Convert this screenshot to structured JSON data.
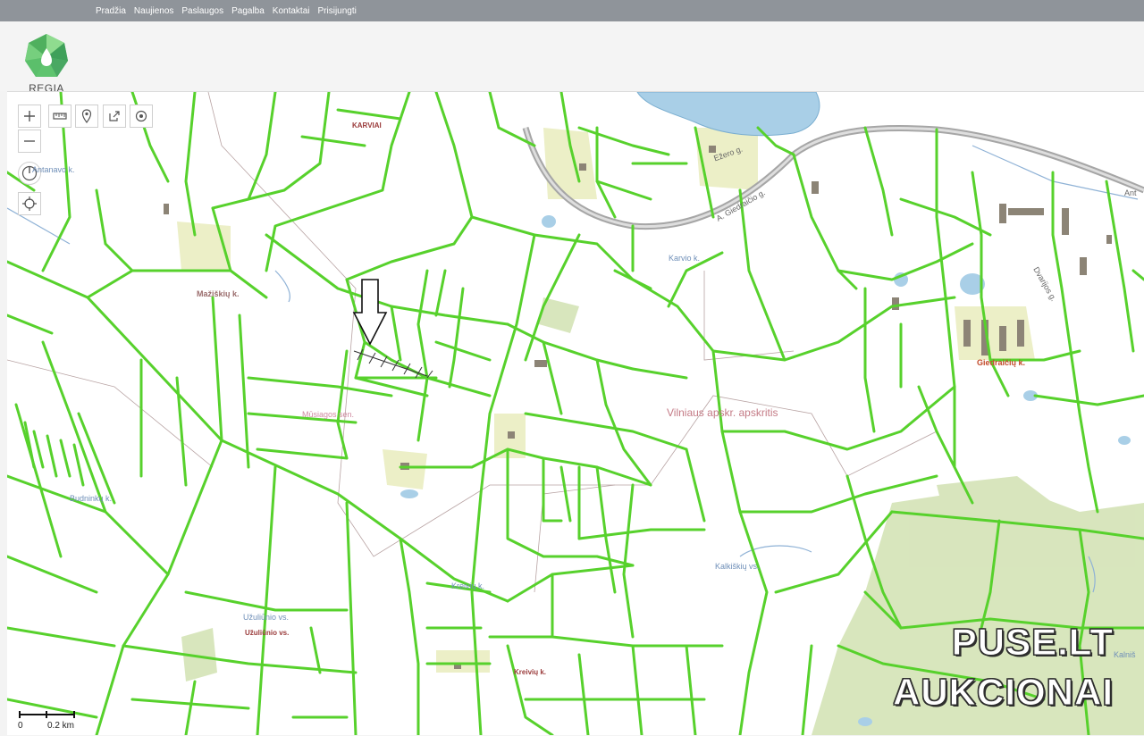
{
  "nav": {
    "items": [
      "Pradžia",
      "Naujienos",
      "Paslaugos",
      "Pagalba",
      "Kontaktai",
      "Prisijungti"
    ]
  },
  "brand": {
    "name": "REGIA"
  },
  "map": {
    "labels": {
      "antanava": "Antanavo k.",
      "karviai_top": "KARVIAI",
      "uezero": "Ežero g.",
      "giedraicio": "A. Giedraičio g.",
      "anyks": "Ant",
      "karvio": "Karvio k.",
      "maziskiu": "Mažiškių k.",
      "giedraiciu_k": "Giedraičių k.",
      "dvaro": "Dvarijos g.",
      "musiagos": "Mūsiagos sen.",
      "region": "Vilniaus apskr. apskritis",
      "budninku": "Budninkų k.",
      "kalkiskiu": "Kalkiškių vs.",
      "kreiviu_blue": "Kreivių k.",
      "uzuliu_blue": "Užuliūnio vs.",
      "uzuliu_red": "Užuliūnio vs.",
      "kreiviu_red": "Kreivių k.",
      "kalnis": "Kalniš"
    },
    "scale": {
      "zero": "0",
      "distance": "0.2 km"
    },
    "colors": {
      "parcel": "#57d12c",
      "water": "#a9cfe7",
      "forest": "#d4e3b6",
      "building": "#8c8476"
    }
  },
  "watermark": {
    "line1": "PUSE.LT",
    "line2": "AUKCIONAI"
  }
}
